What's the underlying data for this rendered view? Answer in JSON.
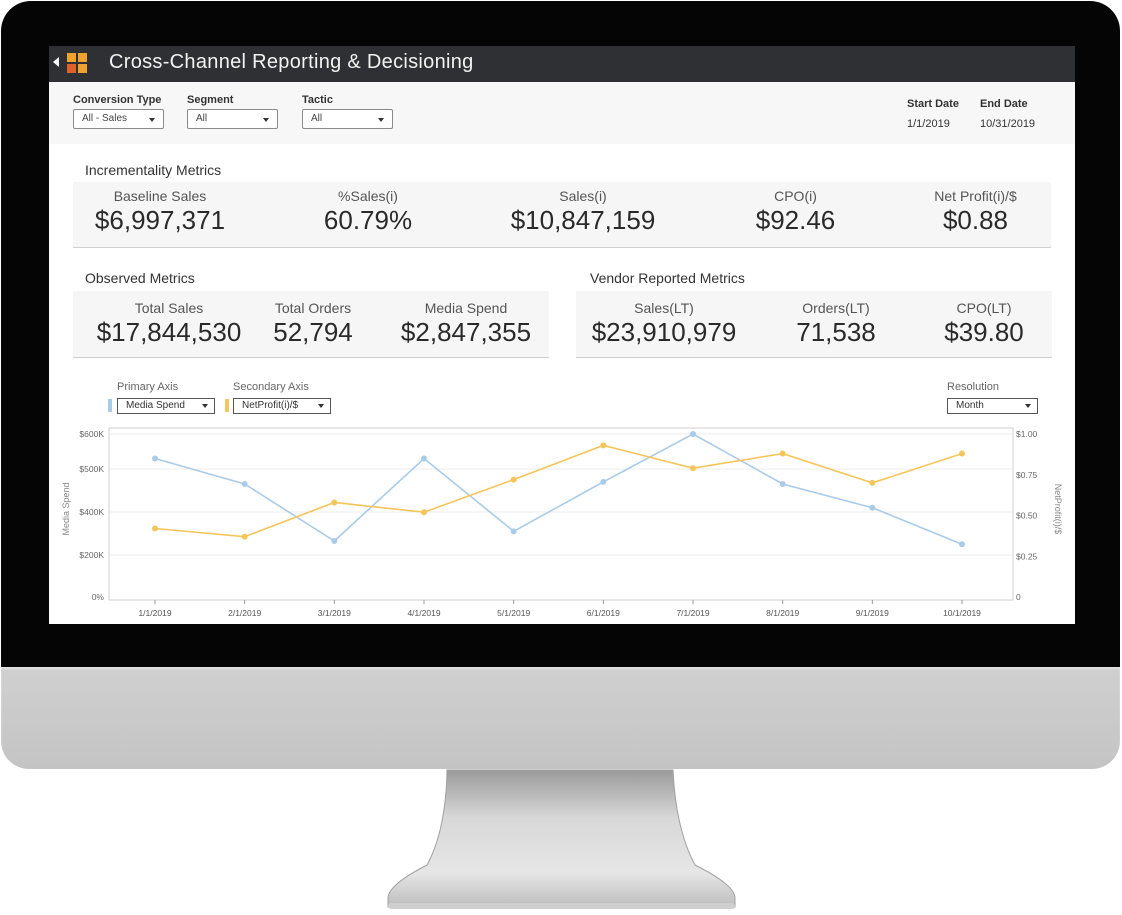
{
  "app": {
    "title": "Cross-Channel Reporting & Decisioning"
  },
  "filters": [
    {
      "label": "Conversion Type",
      "value": "All - Sales"
    },
    {
      "label": "Segment",
      "value": "All"
    },
    {
      "label": "Tactic",
      "value": "All"
    }
  ],
  "dates": {
    "start_label": "Start Date",
    "start_value": "1/1/2019",
    "end_label": "End Date",
    "end_value": "10/31/2019"
  },
  "incrementality": {
    "title": "Incrementality Metrics",
    "metrics": [
      {
        "label": "Baseline Sales",
        "value": "$6,997,371"
      },
      {
        "label": "%Sales(i)",
        "value": "60.79%"
      },
      {
        "label": "Sales(i)",
        "value": "$10,847,159"
      },
      {
        "label": "CPO(i)",
        "value": "$92.46"
      },
      {
        "label": "Net Profit(i)/$",
        "value": "$0.88"
      }
    ]
  },
  "observed": {
    "title": "Observed Metrics",
    "metrics": [
      {
        "label": "Total Sales",
        "value": "$17,844,530"
      },
      {
        "label": "Total Orders",
        "value": "52,794"
      },
      {
        "label": "Media Spend",
        "value": "$2,847,355"
      }
    ]
  },
  "vendor": {
    "title": "Vendor Reported Metrics",
    "metrics": [
      {
        "label": "Sales(LT)",
        "value": "$23,910,979"
      },
      {
        "label": "Orders(LT)",
        "value": "71,538"
      },
      {
        "label": "CPO(LT)",
        "value": "$39.80"
      }
    ]
  },
  "chart_controls": {
    "primary_label": "Primary Axis",
    "primary_value": "Media Spend",
    "secondary_label": "Secondary Axis",
    "secondary_value": "NetProfit(i)/$",
    "resolution_label": "Resolution",
    "resolution_value": "Month"
  },
  "colors": {
    "primary_series": "#a9cbe8",
    "secondary_series": "#f5c55a",
    "titlebar": "#2e3033"
  },
  "icons": [
    "back-arrow-icon",
    "app-grid-logo-icon",
    "chevron-down-icon"
  ],
  "chart_data": {
    "type": "line",
    "categories": [
      "1/1/2019",
      "2/1/2019",
      "3/1/2019",
      "4/1/2019",
      "5/1/2019",
      "6/1/2019",
      "7/1/2019",
      "8/1/2019",
      "9/1/2019",
      "10/1/2019"
    ],
    "series": [
      {
        "name": "Media Spend",
        "axis": "left",
        "values": [
          530000,
          465000,
          265000,
          530000,
          310000,
          470000,
          600000,
          465000,
          410000,
          250000
        ]
      },
      {
        "name": "NetProfit(i)/$",
        "axis": "right",
        "values": [
          0.42,
          0.37,
          0.58,
          0.52,
          0.72,
          0.93,
          0.79,
          0.88,
          0.7,
          0.88
        ]
      }
    ],
    "ylabel": "Media Spend",
    "y2label": "NetProfit(i)/$",
    "yticks": [
      "0%",
      "$200K",
      "$400K",
      "$500K",
      "$600K"
    ],
    "y2ticks": [
      "0",
      "$0.25",
      "$0.50",
      "$0.75",
      "$1.00"
    ],
    "grid": true
  }
}
